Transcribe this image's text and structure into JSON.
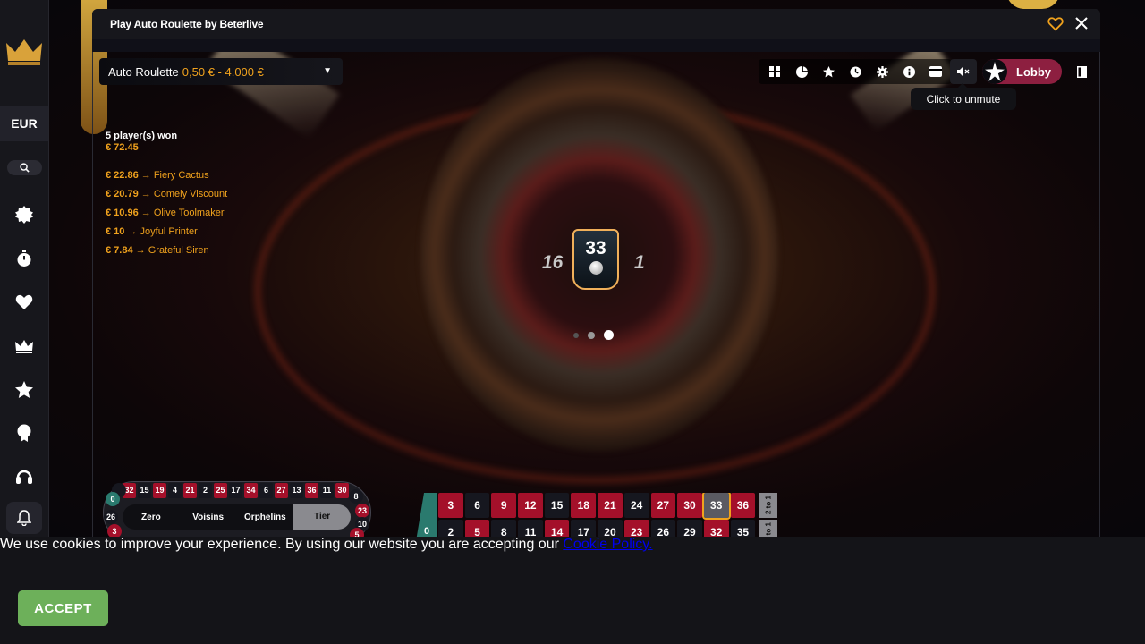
{
  "window": {
    "title": "Play Auto Roulette by Beterlive"
  },
  "rail": {
    "currency": "EUR"
  },
  "table": {
    "name": "Auto Roulette",
    "limits": "0,50 € - 4.000 €"
  },
  "tooltip": {
    "text": "Click to unmute"
  },
  "lobby_label": "Lobby",
  "winners": {
    "header": "5 player(s) won",
    "total": "€ 72.45",
    "list": [
      {
        "amount": "€ 22.86",
        "name": "Fiery Cactus"
      },
      {
        "amount": "€ 20.79",
        "name": "Comely Viscount"
      },
      {
        "amount": "€ 10.96",
        "name": "Olive Toolmaker"
      },
      {
        "amount": "€ 10",
        "name": "Joyful Printer"
      },
      {
        "amount": "€ 7.84",
        "name": "Grateful Siren"
      }
    ]
  },
  "result": {
    "number": "33",
    "left_neighbor": "16",
    "right_neighbor": "1"
  },
  "racetrack": {
    "top_numbers": [
      "32",
      "15",
      "19",
      "4",
      "21",
      "2",
      "25",
      "17",
      "34",
      "6",
      "27",
      "13",
      "36",
      "11",
      "30"
    ],
    "top_colors": [
      "red",
      "blk",
      "red",
      "blk",
      "red",
      "blk",
      "red",
      "blk",
      "red",
      "blk",
      "red",
      "blk",
      "red",
      "blk",
      "red"
    ],
    "left_numbers": [
      "0",
      "26",
      "3"
    ],
    "right_numbers": [
      "8",
      "23",
      "10",
      "5"
    ],
    "sections": [
      "Zero",
      "Voisins",
      "Orphelins",
      "Tier"
    ]
  },
  "board": {
    "zero": "0",
    "row1": [
      "3",
      "6",
      "9",
      "12",
      "15",
      "18",
      "21",
      "24",
      "27",
      "30",
      "33",
      "36"
    ],
    "row1_colors": [
      "red",
      "blk",
      "red",
      "red",
      "blk",
      "red",
      "red",
      "blk",
      "red",
      "red",
      "hl",
      "red"
    ],
    "row2": [
      "2",
      "5",
      "8",
      "11",
      "14",
      "17",
      "20",
      "23",
      "26",
      "29",
      "32",
      "35"
    ],
    "row2_colors": [
      "blk",
      "red",
      "blk",
      "blk",
      "red",
      "blk",
      "blk",
      "red",
      "blk",
      "blk",
      "red",
      "blk"
    ],
    "column_bet": "2 to 1",
    "column_bet_2": "2 to 1"
  },
  "cookie": {
    "text": "We use cookies to improve your experience. By using our website you are accepting our ",
    "link": "Cookie Policy.",
    "accept": "ACCEPT"
  },
  "colors": {
    "accent": "#f0a21d",
    "lobby": "#8d1f40",
    "accept": "#6db05a"
  }
}
